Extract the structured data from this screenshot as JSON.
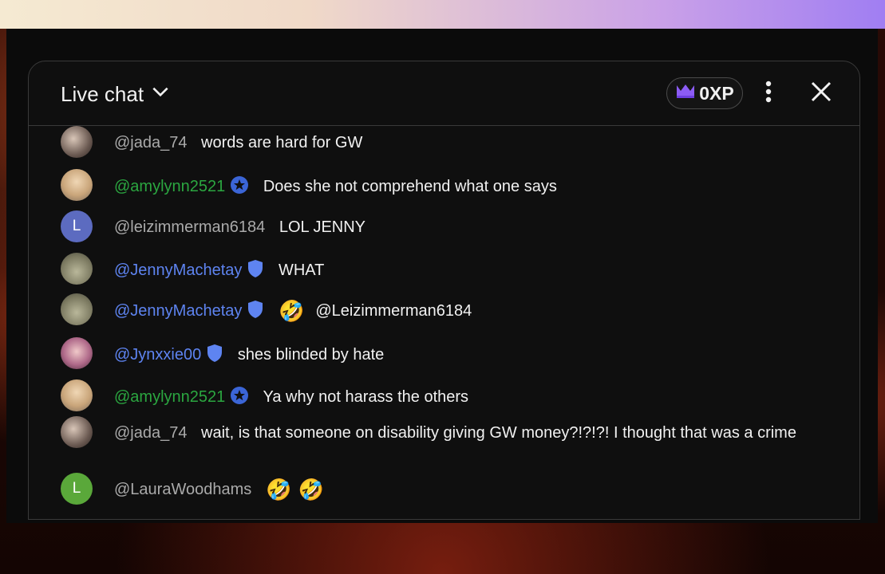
{
  "header": {
    "title": "Live chat",
    "xp_label": "0XP"
  },
  "messages": [
    {
      "author": "@jada_74",
      "text": "words are hard for GW"
    },
    {
      "author": "@amylynn2521",
      "text": "Does she not comprehend what one says"
    },
    {
      "author": "@leizimmerman6184",
      "text": "LOL JENNY",
      "avatar_letter": "L"
    },
    {
      "author": "@JennyMachetay",
      "text": "WHAT"
    },
    {
      "author": "@JennyMachetay",
      "emoji": "🤣",
      "text": "@Leizimmerman6184"
    },
    {
      "author": "@Jynxxie00",
      "text": "shes blinded by hate"
    },
    {
      "author": "@amylynn2521",
      "text": "Ya why not harass the others"
    },
    {
      "author": "@jada_74",
      "text": "wait, is that someone on disability giving GW money?!?!?! I thought that was a crime"
    },
    {
      "author": "@LauraWoodhams",
      "emoji": "🤣",
      "emoji2": "🤣",
      "avatar_letter": "L"
    }
  ],
  "colors": {
    "member_name": "#2ba640",
    "moderator_name": "#5e84f1",
    "regular_name": "#aaaaaa",
    "message_text": "#f1f1f1",
    "xp_crown": "#8c5cf5",
    "avatar_purple": "#5c6bc0",
    "avatar_green": "#5aa83a"
  },
  "icons": {
    "dropdown": "chevron-down-icon",
    "crown": "crown-icon",
    "more": "more-vert-icon",
    "close": "close-icon",
    "member_badge": "star-badge-icon",
    "moderator_badge": "shield-badge-icon"
  }
}
